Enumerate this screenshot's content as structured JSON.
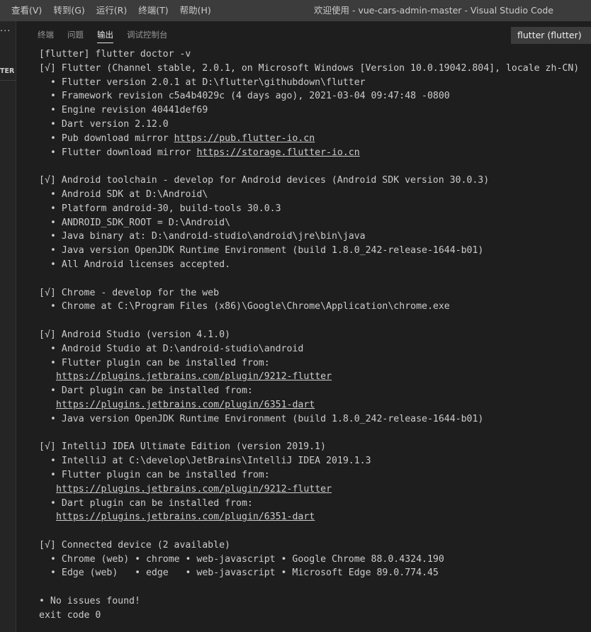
{
  "titlebar": {
    "menu": [
      "查看(V)",
      "转到(G)",
      "运行(R)",
      "终端(T)",
      "帮助(H)"
    ],
    "window_title": "欢迎使用 - vue-cars-admin-master - Visual Studio Code"
  },
  "sidebar": {
    "more_icon": "ellipsis-icon",
    "section_label": "TER"
  },
  "panel": {
    "tabs": [
      "终端",
      "问题",
      "输出",
      "调试控制台"
    ],
    "active_tab": "输出",
    "output_channel": "flutter (flutter)"
  },
  "output": {
    "lines": [
      {
        "text": "[flutter] flutter doctor -v"
      },
      {
        "text": "[√] Flutter (Channel stable, 2.0.1, on Microsoft Windows [Version 10.0.19042.804], locale zh-CN)"
      },
      {
        "text": "• Flutter version 2.0.1 at D:\\flutter\\githubdown\\flutter",
        "indent": 1
      },
      {
        "text": "• Framework revision c5a4b4029c (4 days ago), 2021-03-04 09:47:48 -0800",
        "indent": 1
      },
      {
        "text": "• Engine revision 40441def69",
        "indent": 1
      },
      {
        "text": "• Dart version 2.12.0",
        "indent": 1
      },
      {
        "text": "• Pub download mirror ",
        "link": "https://pub.flutter-io.cn",
        "indent": 1
      },
      {
        "text": "• Flutter download mirror ",
        "link": "https://storage.flutter-io.cn",
        "indent": 1
      },
      {
        "text": ""
      },
      {
        "text": "[√] Android toolchain - develop for Android devices (Android SDK version 30.0.3)"
      },
      {
        "text": "• Android SDK at D:\\Android\\",
        "indent": 1
      },
      {
        "text": "• Platform android-30, build-tools 30.0.3",
        "indent": 1
      },
      {
        "text": "• ANDROID_SDK_ROOT = D:\\Android\\",
        "indent": 1
      },
      {
        "text": "• Java binary at: D:\\android-studio\\android\\jre\\bin\\java",
        "indent": 1
      },
      {
        "text": "• Java version OpenJDK Runtime Environment (build 1.8.0_242-release-1644-b01)",
        "indent": 1
      },
      {
        "text": "• All Android licenses accepted.",
        "indent": 1
      },
      {
        "text": ""
      },
      {
        "text": "[√] Chrome - develop for the web"
      },
      {
        "text": "• Chrome at C:\\Program Files (x86)\\Google\\Chrome\\Application\\chrome.exe",
        "indent": 1
      },
      {
        "text": ""
      },
      {
        "text": "[√] Android Studio (version 4.1.0)"
      },
      {
        "text": "• Android Studio at D:\\android-studio\\android",
        "indent": 1
      },
      {
        "text": "• Flutter plugin can be installed from:",
        "indent": 1
      },
      {
        "text": "",
        "link": "https://plugins.jetbrains.com/plugin/9212-flutter",
        "indent": 2
      },
      {
        "text": "• Dart plugin can be installed from:",
        "indent": 1
      },
      {
        "text": "",
        "link": "https://plugins.jetbrains.com/plugin/6351-dart",
        "indent": 2
      },
      {
        "text": "• Java version OpenJDK Runtime Environment (build 1.8.0_242-release-1644-b01)",
        "indent": 1
      },
      {
        "text": ""
      },
      {
        "text": "[√] IntelliJ IDEA Ultimate Edition (version 2019.1)"
      },
      {
        "text": "• IntelliJ at C:\\develop\\JetBrains\\IntelliJ IDEA 2019.1.3",
        "indent": 1
      },
      {
        "text": "• Flutter plugin can be installed from:",
        "indent": 1
      },
      {
        "text": "",
        "link": "https://plugins.jetbrains.com/plugin/9212-flutter",
        "indent": 2
      },
      {
        "text": "• Dart plugin can be installed from:",
        "indent": 1
      },
      {
        "text": "",
        "link": "https://plugins.jetbrains.com/plugin/6351-dart",
        "indent": 2
      },
      {
        "text": ""
      },
      {
        "text": "[√] Connected device (2 available)"
      },
      {
        "text": "• Chrome (web) • chrome • web-javascript • Google Chrome 88.0.4324.190",
        "indent": 1
      },
      {
        "text": "• Edge (web)   • edge   • web-javascript • Microsoft Edge 89.0.774.45",
        "indent": 1
      },
      {
        "text": ""
      },
      {
        "text": "• No issues found!"
      },
      {
        "text": "exit code 0"
      }
    ]
  }
}
